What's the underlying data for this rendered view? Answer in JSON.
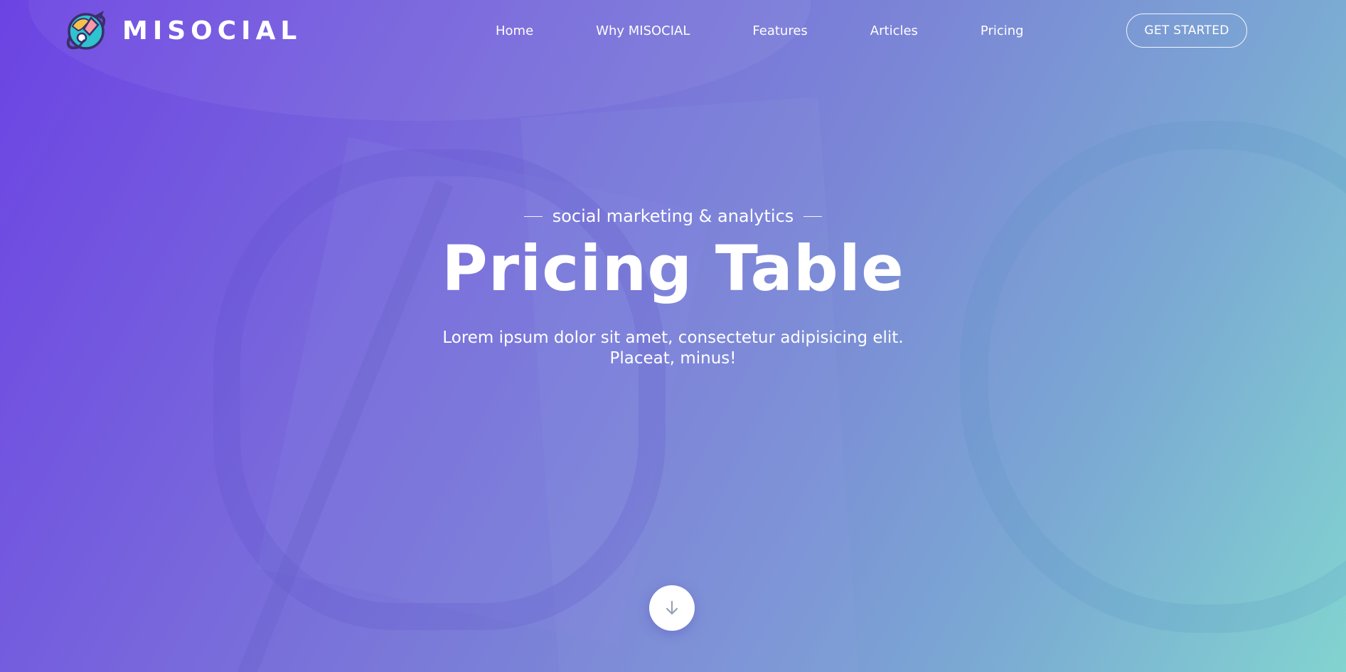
{
  "brand": {
    "name": "MISOCIAL",
    "logo_icon": "planet-rocket-icon"
  },
  "nav": {
    "items": [
      {
        "label": "Home"
      },
      {
        "label": "Why MISOCIAL"
      },
      {
        "label": "Features"
      },
      {
        "label": "Articles"
      },
      {
        "label": "Pricing"
      }
    ],
    "cta_label": "GET STARTED"
  },
  "hero": {
    "kicker": "social marketing & analytics",
    "title": "Pricing Table",
    "subtitle": "Lorem ipsum dolor sit amet, consectetur adipisicing elit. Placeat, minus!",
    "scroll_icon": "arrow-down-icon"
  },
  "colors": {
    "gradient_start": "#6c43e3",
    "gradient_end": "#82d4d0",
    "text": "#ffffff"
  }
}
